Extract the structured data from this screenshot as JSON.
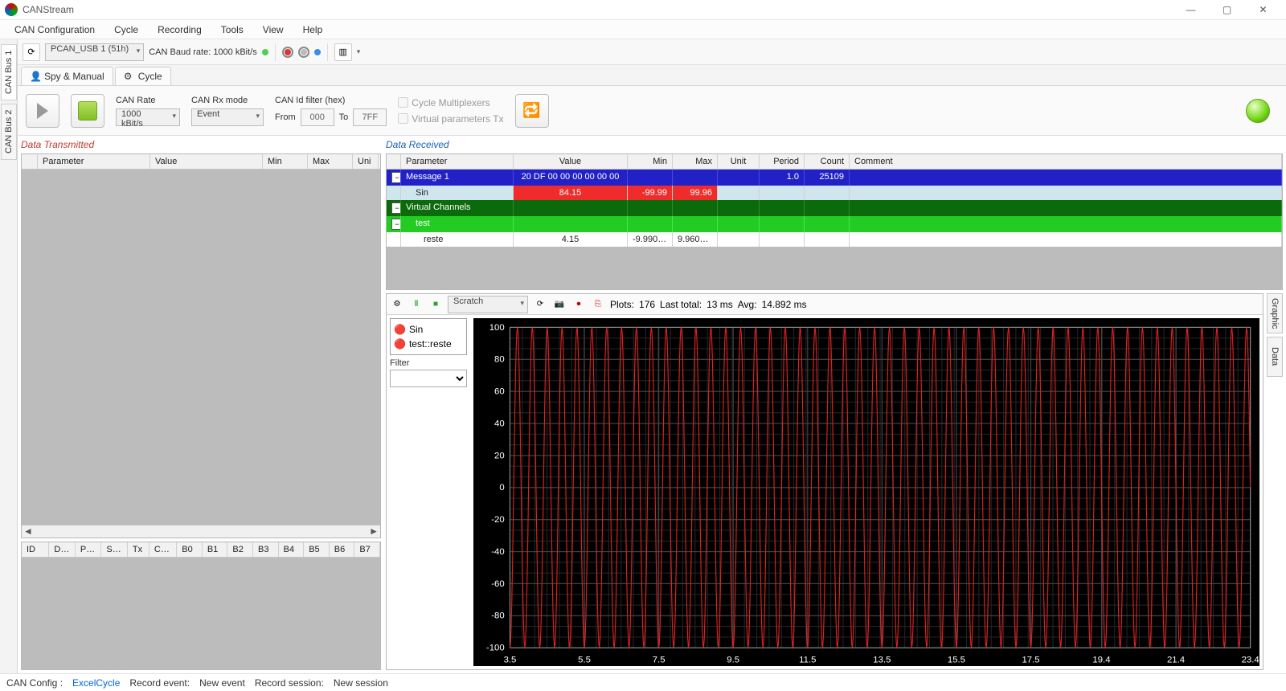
{
  "title": "CANStream",
  "menu": [
    "CAN Configuration",
    "Cycle",
    "Recording",
    "Tools",
    "View",
    "Help"
  ],
  "sidetabs": [
    "CAN Bus 1",
    "CAN Bus 2"
  ],
  "toolbar": {
    "device": "PCAN_USB 1 (51h)",
    "baud_label": "CAN Baud rate: 1000 kBit/s"
  },
  "modetabs": {
    "spy": "Spy & Manual",
    "cycle": "Cycle"
  },
  "controls": {
    "rate_label": "CAN Rate",
    "rate_value": "1000 kBit/s",
    "rxmode_label": "CAN Rx mode",
    "rxmode_value": "Event",
    "idfilter_label": "CAN Id filter (hex)",
    "from_label": "From",
    "from_value": "000",
    "to_label": "To",
    "to_value": "7FF",
    "chk_mux": "Cycle Multiplexers",
    "chk_virt": "Virtual parameters Tx"
  },
  "sections": {
    "tx": "Data Transmitted",
    "rx": "Data Received"
  },
  "tx_headers": [
    "",
    "Parameter",
    "Value",
    "Min",
    "Max",
    "Uni"
  ],
  "msg_headers": [
    "ID",
    "DLC",
    "Perio",
    "Send",
    "Tx",
    "Coun",
    "B0",
    "B1",
    "B2",
    "B3",
    "B4",
    "B5",
    "B6",
    "B7"
  ],
  "rx_headers": [
    "Parameter",
    "Value",
    "Min",
    "Max",
    "Unit",
    "Period",
    "Count",
    "Comment"
  ],
  "rx_rows": {
    "message": {
      "name": "Message 1",
      "value": "20 DF 00 00 00 00 00 00",
      "period": "1.0",
      "count": "25109"
    },
    "sin": {
      "name": "Sin",
      "value": "84.15",
      "min": "-99.99",
      "max": "99.96"
    },
    "vchannels": {
      "name": "Virtual Channels"
    },
    "test": {
      "name": "test"
    },
    "reste": {
      "name": "reste",
      "value": "4.15",
      "min": "-9.99000...",
      "max": "9.96000..."
    }
  },
  "graph": {
    "scratch": "Scratch",
    "stats": {
      "plots_lbl": "Plots:",
      "plots": "176",
      "last_lbl": "Last total:",
      "last": "13 ms",
      "avg_lbl": "Avg:",
      "avg": "14.892 ms"
    },
    "signals": [
      "Sin",
      "test::reste"
    ],
    "filter_label": "Filter"
  },
  "right_tabs": [
    "Graphic",
    "Data"
  ],
  "status": {
    "cfg_lbl": "CAN Config :",
    "cfg_val": "ExcelCycle",
    "rec_evt_lbl": "Record event:",
    "rec_evt_val": "New event",
    "rec_sess_lbl": "Record session:",
    "rec_sess_val": "New session"
  },
  "chart_data": {
    "type": "line",
    "title": "",
    "xlabel": "",
    "ylabel": "",
    "xlim": [
      3.5,
      23.4
    ],
    "ylim": [
      -100,
      100
    ],
    "yticks": [
      -100,
      -80,
      -60,
      -40,
      -20,
      0,
      20,
      40,
      60,
      80,
      100
    ],
    "xticks": [
      3.5,
      5.5,
      7.5,
      9.5,
      11.5,
      13.5,
      15.5,
      17.5,
      19.4,
      21.4,
      23.4
    ],
    "series": [
      {
        "name": "Sin",
        "color": "#d22",
        "frequency_hz_approx": 2.5,
        "amplitude": 100,
        "note": "dense sinusoid ~50 cycles across visible range; values estimated from axes"
      }
    ]
  }
}
